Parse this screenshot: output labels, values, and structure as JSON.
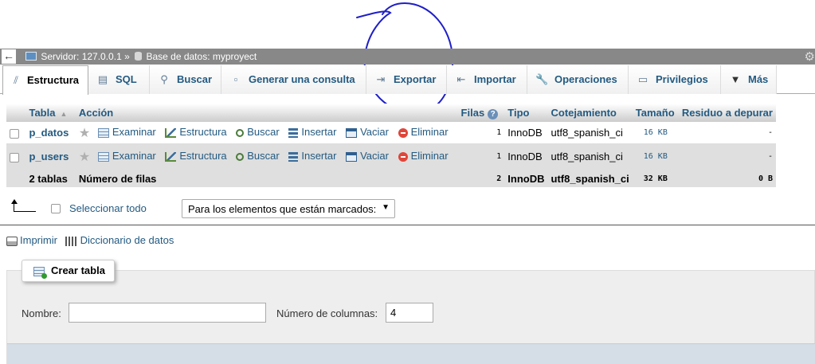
{
  "breadcrumb": {
    "back": "←",
    "server": "Servidor: 127.0.0.1",
    "separator": "»",
    "database": "Base de datos: myproyect"
  },
  "tabs": [
    {
      "label": "Estructura",
      "icon": "structure-icon",
      "active": true
    },
    {
      "label": "SQL",
      "icon": "sql-icon"
    },
    {
      "label": "Buscar",
      "icon": "search-icon"
    },
    {
      "label": "Generar una consulta",
      "icon": "query-icon"
    },
    {
      "label": "Exportar",
      "icon": "export-icon"
    },
    {
      "label": "Importar",
      "icon": "import-icon"
    },
    {
      "label": "Operaciones",
      "icon": "wrench-icon"
    },
    {
      "label": "Privilegios",
      "icon": "privileges-icon"
    },
    {
      "label": "Más",
      "icon": "caret-down-icon"
    }
  ],
  "table": {
    "headers": {
      "tabla": "Tabla",
      "accion": "Acción",
      "filas": "Filas",
      "tipo": "Tipo",
      "cotejamiento": "Cotejamiento",
      "tamano": "Tamaño",
      "residuo": "Residuo a depurar"
    },
    "actions": {
      "examinar": "Examinar",
      "estructura": "Estructura",
      "buscar": "Buscar",
      "insertar": "Insertar",
      "vaciar": "Vaciar",
      "eliminar": "Eliminar"
    },
    "rows": [
      {
        "name": "p_datos",
        "rows": "1",
        "type": "InnoDB",
        "collation": "utf8_spanish_ci",
        "size": "16 KB",
        "overhead": "-"
      },
      {
        "name": "p_users",
        "rows": "1",
        "type": "InnoDB",
        "collation": "utf8_spanish_ci",
        "size": "16 KB",
        "overhead": "-"
      }
    ],
    "footer": {
      "count": "2 tablas",
      "label": "Número de filas",
      "rows": "2",
      "type": "InnoDB",
      "collation": "utf8_spanish_ci",
      "size": "32 KB",
      "overhead": "0 B"
    }
  },
  "bulk": {
    "select_all": "Seleccionar todo",
    "dropdown": "Para los elementos que están marcados:"
  },
  "links": {
    "print": "Imprimir",
    "dictionary": "Diccionario de datos"
  },
  "create": {
    "legend": "Crear tabla",
    "name_label": "Nombre:",
    "name_value": "",
    "columns_label": "Número de columnas:",
    "columns_value": "4"
  },
  "colors": {
    "link": "#235a81",
    "topbar": "#888888",
    "annotation": "#1f1fc8"
  }
}
